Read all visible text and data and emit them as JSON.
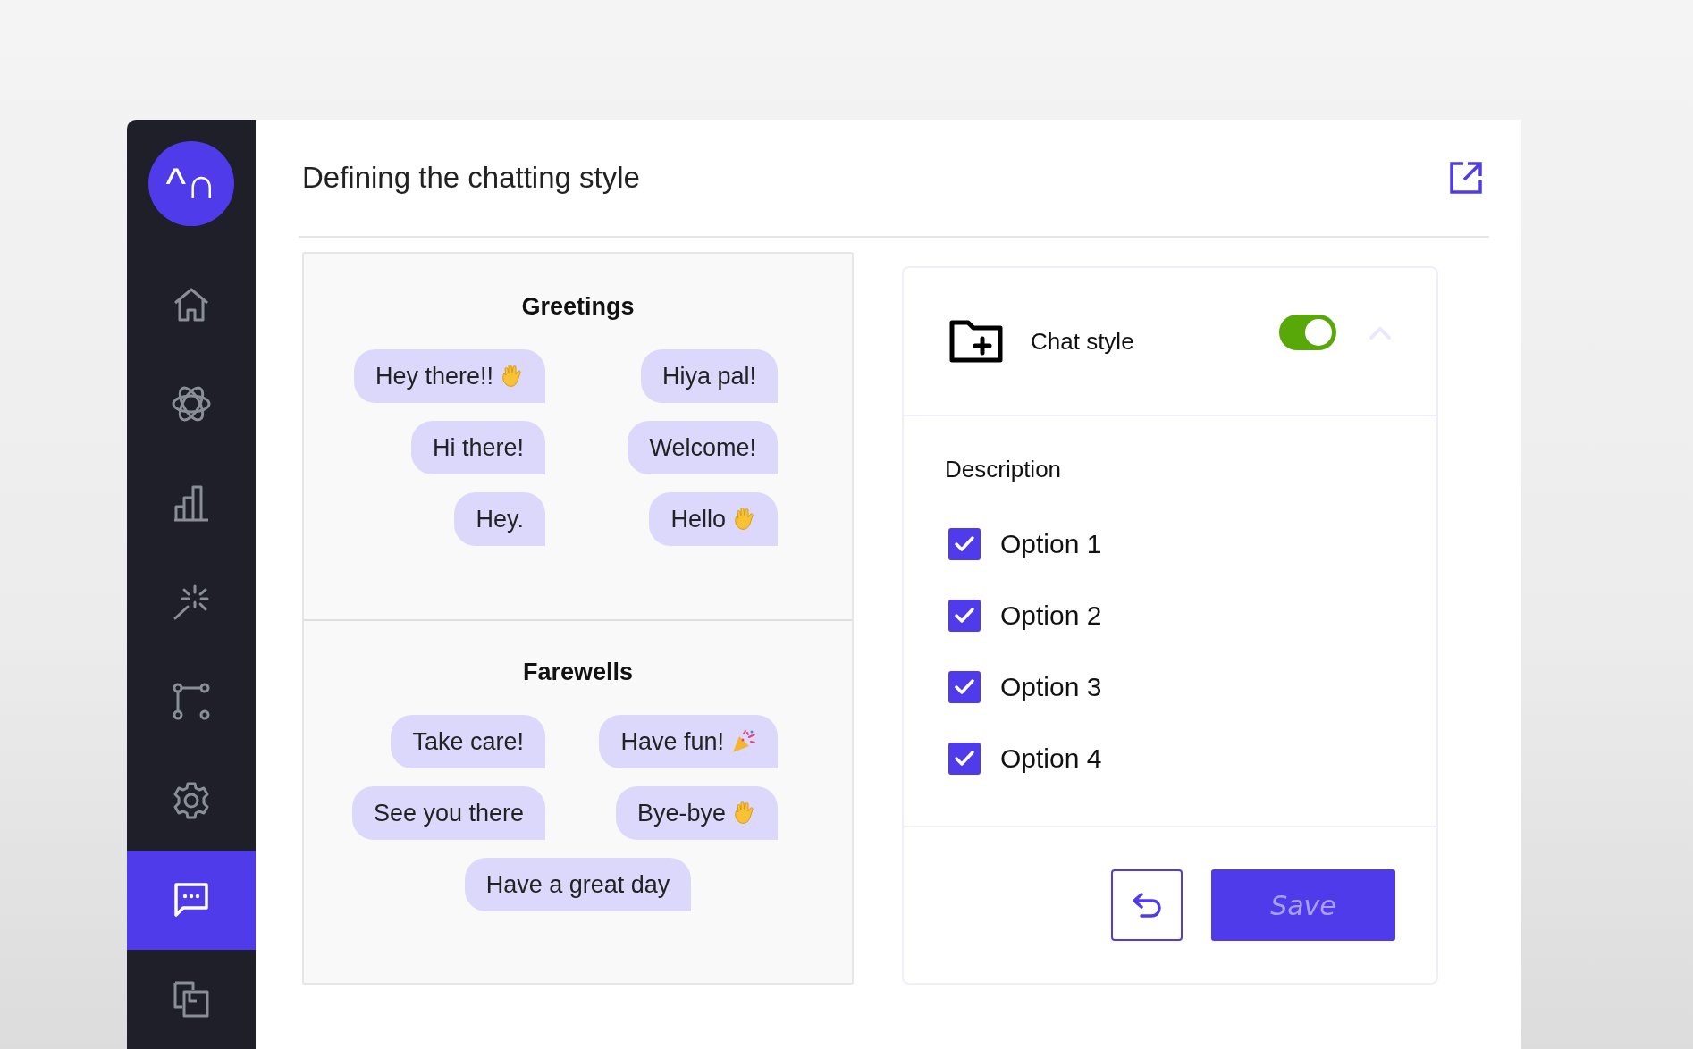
{
  "sidebar": {
    "logo": "^∩",
    "items": [
      {
        "kind": "home",
        "selected": false
      },
      {
        "kind": "atom",
        "selected": false
      },
      {
        "kind": "chart",
        "selected": false
      },
      {
        "kind": "sparkle",
        "selected": false
      },
      {
        "kind": "flow",
        "selected": false
      },
      {
        "kind": "settings",
        "selected": false
      },
      {
        "kind": "chat",
        "selected": true
      },
      {
        "kind": "copy",
        "selected": false
      }
    ]
  },
  "header": {
    "title": "Defining the chatting style"
  },
  "sections": [
    {
      "title": "Greetings",
      "rows": [
        [
          {
            "text": "Hey there!!",
            "kind": "wave"
          },
          {
            "text": "Hiya pal!",
            "kind": "plain"
          }
        ],
        [
          {
            "text": "Hi there!",
            "kind": "plain"
          },
          {
            "text": "Welcome!",
            "kind": "plain"
          }
        ],
        [
          {
            "text": "Hey.",
            "kind": "plain"
          },
          {
            "text": "Hello",
            "kind": "wave"
          }
        ]
      ]
    },
    {
      "title": "Farewells",
      "rows": [
        [
          {
            "text": "Take care!",
            "kind": "plain"
          },
          {
            "text": "Have fun!",
            "kind": "party"
          }
        ],
        [
          {
            "text": "See you there",
            "kind": "plain"
          },
          {
            "text": "Bye-bye",
            "kind": "wave"
          }
        ],
        [
          {
            "text": "Have a great day",
            "kind": "plain"
          }
        ]
      ]
    }
  ],
  "panel": {
    "title": "Chat style",
    "on": true,
    "expanded": true,
    "description": "Description",
    "options": [
      {
        "label": "Option 1",
        "checked": true
      },
      {
        "label": "Option 2",
        "checked": true
      },
      {
        "label": "Option 3",
        "checked": true
      },
      {
        "label": "Option 4",
        "checked": true
      }
    ],
    "save": "Save"
  }
}
